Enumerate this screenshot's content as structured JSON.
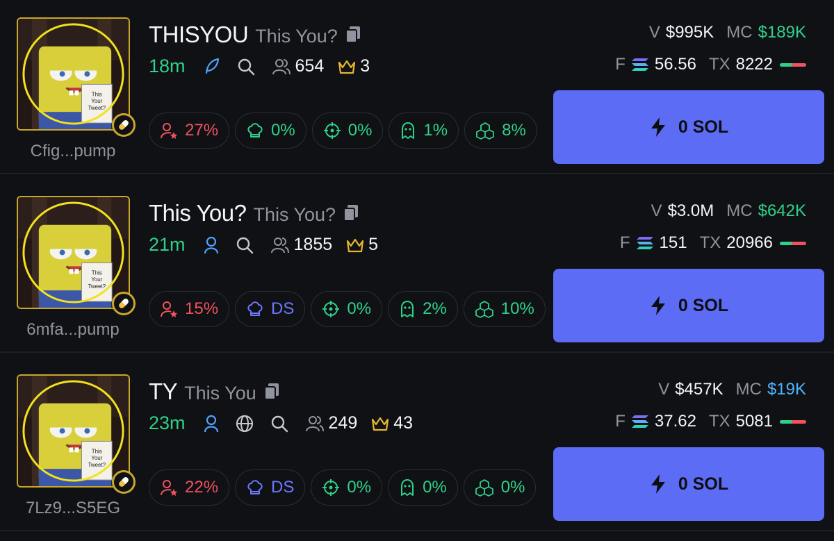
{
  "colors": {
    "background": "#101114",
    "accent_green": "#2fd18a",
    "accent_red": "#f0525f",
    "accent_blue": "#6b78ff",
    "button": "#5c6cf5",
    "gold": "#c9a72a",
    "muted": "#8f949e"
  },
  "tokens": [
    {
      "ticker": "THISYOU",
      "name": "This You?",
      "address": "Cfig...pump",
      "age": "18m",
      "holders": "654",
      "pro_traders": "3",
      "social_icons": [
        "feather-icon",
        "search-icon"
      ],
      "chips": {
        "top10": "27%",
        "dev": "0%",
        "snipers": "0%",
        "insiders": "1%",
        "bundlers": "8%"
      },
      "volume_label": "V",
      "volume": "$995K",
      "mc_label": "MC",
      "mc": "$189K",
      "fee_label": "F",
      "fees": "56.56",
      "tx_label": "TX",
      "txs": "8222",
      "buy_label": "0 SOL"
    },
    {
      "ticker": "This You?",
      "name": "This You?",
      "address": "6mfa...pump",
      "age": "21m",
      "holders": "1855",
      "pro_traders": "5",
      "social_icons": [
        "user-icon",
        "search-icon"
      ],
      "chips": {
        "top10": "15%",
        "dev": "DS",
        "snipers": "0%",
        "insiders": "2%",
        "bundlers": "10%"
      },
      "volume_label": "V",
      "volume": "$3.0M",
      "mc_label": "MC",
      "mc": "$642K",
      "fee_label": "F",
      "fees": "151",
      "tx_label": "TX",
      "txs": "20966",
      "buy_label": "0 SOL"
    },
    {
      "ticker": "TY",
      "name": "This You",
      "address": "7Lz9...S5EG",
      "age": "23m",
      "holders": "249",
      "pro_traders": "43",
      "social_icons": [
        "user-icon",
        "globe-icon",
        "search-icon"
      ],
      "chips": {
        "top10": "22%",
        "dev": "DS",
        "snipers": "0%",
        "insiders": "0%",
        "bundlers": "0%"
      },
      "volume_label": "V",
      "volume": "$457K",
      "mc_label": "MC",
      "mc": "$19K",
      "fee_label": "F",
      "fees": "37.62",
      "tx_label": "TX",
      "txs": "5081",
      "buy_label": "0 SOL"
    }
  ],
  "avatar_image": {
    "text_lines": [
      "This",
      "Your",
      "Tweet?"
    ]
  }
}
